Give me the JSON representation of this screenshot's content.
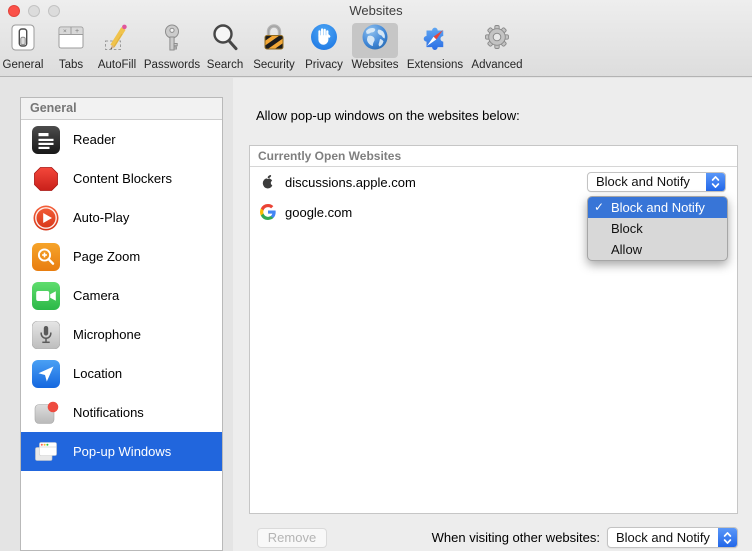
{
  "window": {
    "title": "Websites"
  },
  "toolbar": {
    "items": [
      {
        "label": "General",
        "icon": "general-icon"
      },
      {
        "label": "Tabs",
        "icon": "tabs-icon"
      },
      {
        "label": "AutoFill",
        "icon": "autofill-icon"
      },
      {
        "label": "Passwords",
        "icon": "passwords-icon"
      },
      {
        "label": "Search",
        "icon": "search-icon"
      },
      {
        "label": "Security",
        "icon": "security-icon"
      },
      {
        "label": "Privacy",
        "icon": "privacy-icon"
      },
      {
        "label": "Websites",
        "icon": "websites-icon",
        "selected": true
      },
      {
        "label": "Extensions",
        "icon": "extensions-icon"
      },
      {
        "label": "Advanced",
        "icon": "advanced-icon"
      }
    ]
  },
  "sidebar": {
    "header": "General",
    "items": [
      {
        "label": "Reader",
        "icon": "reader-icon"
      },
      {
        "label": "Content Blockers",
        "icon": "content-blockers-icon"
      },
      {
        "label": "Auto-Play",
        "icon": "auto-play-icon"
      },
      {
        "label": "Page Zoom",
        "icon": "page-zoom-icon"
      },
      {
        "label": "Camera",
        "icon": "camera-icon"
      },
      {
        "label": "Microphone",
        "icon": "microphone-icon"
      },
      {
        "label": "Location",
        "icon": "location-icon"
      },
      {
        "label": "Notifications",
        "icon": "notifications-icon"
      },
      {
        "label": "Pop-up Windows",
        "icon": "popup-windows-icon",
        "selected": true
      }
    ]
  },
  "main": {
    "heading": "Allow pop-up windows on the websites below:",
    "table": {
      "section_header": "Currently Open Websites",
      "rows": [
        {
          "site": "discussions.apple.com",
          "icon": "apple-icon",
          "setting": "Block and Notify"
        },
        {
          "site": "google.com",
          "icon": "google-icon"
        }
      ]
    },
    "dropdown_menu": {
      "items": [
        {
          "label": "Block and Notify",
          "check": "✓",
          "selected": true
        },
        {
          "label": "Block"
        },
        {
          "label": "Allow"
        }
      ]
    },
    "footer": {
      "remove_label": "Remove",
      "when_visiting_label": "When visiting other websites:",
      "when_visiting_value": "Block and Notify"
    }
  },
  "colors": {
    "sidebar_selection": "#2166dd",
    "menu_highlight": "#3875d7",
    "stepper_blue": "#2267e9",
    "toolbar_selected_bg": "#c6c6c6",
    "window_bg": "#e4e4e4"
  }
}
